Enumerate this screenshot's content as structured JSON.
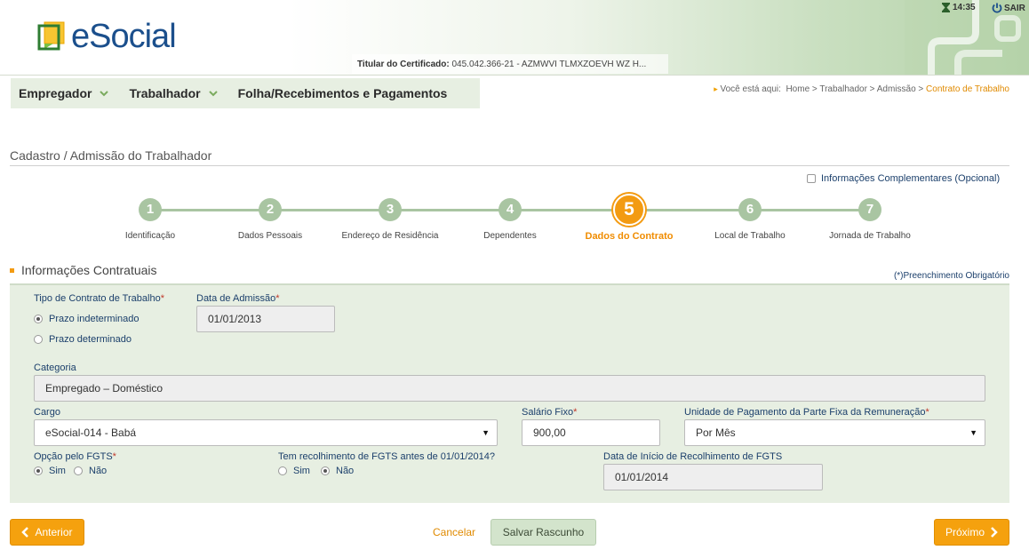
{
  "header": {
    "logo_text": "eSocial",
    "certificate_label": "Titular do Certificado:",
    "certificate_value": "045.042.366-21 - AZMWVI TLMXZOEVH WZ H...",
    "time": "14:35",
    "logout_label": "SAIR"
  },
  "nav": {
    "items": [
      {
        "label": "Empregador",
        "has_dropdown": true
      },
      {
        "label": "Trabalhador",
        "has_dropdown": true
      },
      {
        "label": "Folha/Recebimentos e Pagamentos",
        "has_dropdown": false
      }
    ]
  },
  "breadcrumb": {
    "prefix": "Você está aqui:",
    "path": "Home > Trabalhador > Admissão >",
    "current": "Contrato de Trabalho"
  },
  "page": {
    "title": "Cadastro / Admissão do Trabalhador",
    "optional_info_label": "Informações Complementares (Opcional)"
  },
  "stepper": {
    "active_index": 5,
    "steps": [
      {
        "num": "1",
        "label": "Identificação"
      },
      {
        "num": "2",
        "label": "Dados Pessoais"
      },
      {
        "num": "3",
        "label": "Endereço de Residência"
      },
      {
        "num": "4",
        "label": "Dependentes"
      },
      {
        "num": "5",
        "label": "Dados do Contrato"
      },
      {
        "num": "6",
        "label": "Local de Trabalho"
      },
      {
        "num": "7",
        "label": "Jornada de Trabalho"
      }
    ]
  },
  "section": {
    "title": "Informações Contratuais",
    "required_note": "(*)Preenchimento Obrigatório"
  },
  "form": {
    "tipo_contrato_label": "Tipo de Contrato de Trabalho",
    "tipo_contrato_options": [
      "Prazo indeterminado",
      "Prazo determinado"
    ],
    "tipo_contrato_selected": "Prazo indeterminado",
    "data_admissao_label": "Data de Admissão",
    "data_admissao_value": "01/01/2013",
    "categoria_label": "Categoria",
    "categoria_value": "Empregado – Doméstico",
    "cargo_label": "Cargo",
    "cargo_value": "eSocial-014 - Babá",
    "salario_label": "Salário Fixo",
    "salario_value": "900,00",
    "unidade_label": "Unidade de Pagamento da Parte Fixa da Remuneração",
    "unidade_value": "Por Mês",
    "fgts_label": "Opção pelo FGTS",
    "fgts_options": [
      "Sim",
      "Não"
    ],
    "fgts_selected": "Sim",
    "recolh_label": "Tem recolhimento de FGTS antes de 01/01/2014?",
    "recolh_options": [
      "Sim",
      "Não"
    ],
    "recolh_selected": "Não",
    "data_inicio_label": "Data de Início de Recolhimento de FGTS",
    "data_inicio_value": "01/01/2014",
    "required_mark": "*"
  },
  "actions": {
    "back_label": "Anterior",
    "cancel_label": "Cancelar",
    "draft_label": "Salvar Rascunho",
    "next_label": "Próximo"
  },
  "colors": {
    "accent": "#f39b12",
    "brand": "#1b4f8c",
    "panel": "#e7efe2",
    "step": "#a9c5a2"
  }
}
